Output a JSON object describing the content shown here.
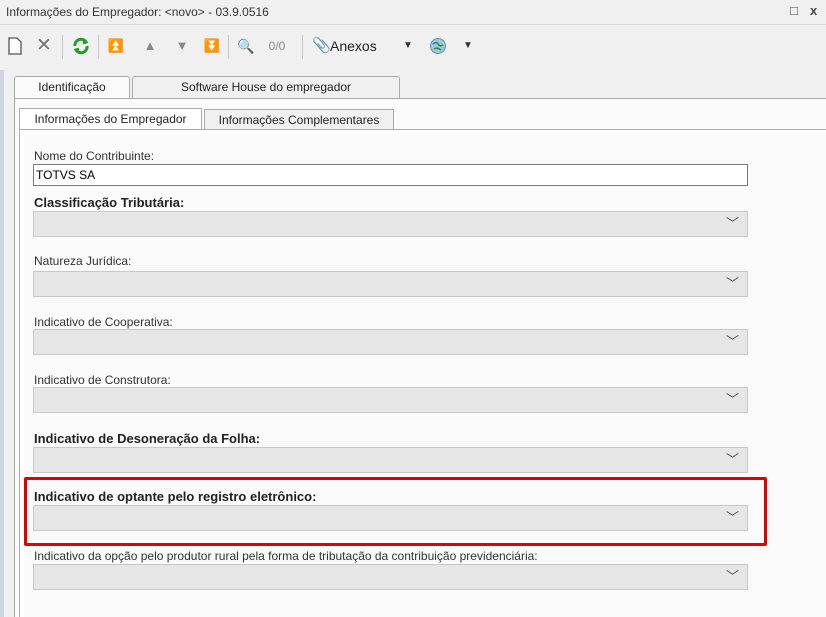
{
  "window": {
    "title": "Informações do Empregador: <novo> - 03.9.0516",
    "restore_glyph": "□",
    "close_glyph": "x"
  },
  "toolbar": {
    "anexos_label": "Anexos",
    "counter": "0/0",
    "icons": [
      "new-icon",
      "delete-icon",
      "refresh-icon",
      "first-icon",
      "prev-icon",
      "next-icon",
      "last-icon",
      "search-icon",
      "paperclip-icon",
      "globe-icon"
    ]
  },
  "tabs_top": [
    "Identificação",
    "Software House do empregador"
  ],
  "tabs_sub": [
    "Informações do Empregador",
    "Informações Complementares"
  ],
  "form": {
    "nome_label": "Nome do Contribuinte:",
    "nome_value": "TOTVS SA",
    "classificacao_label": "Classificação Tributária:",
    "natureza_label": "Natureza Jurídica:",
    "cooperativa_label": "Indicativo de Cooperativa:",
    "construtora_label": "Indicativo de Construtora:",
    "desoneracao_label": "Indicativo de Desoneração da Folha:",
    "registro_label": "Indicativo de optante pelo registro eletrônico:",
    "produtor_label": "Indicativo da opção pelo produtor rural pela forma de tributação da contribuição previdenciária:"
  },
  "colors": {
    "highlight": "#e00000",
    "refresh_green": "#2a9a2a"
  }
}
